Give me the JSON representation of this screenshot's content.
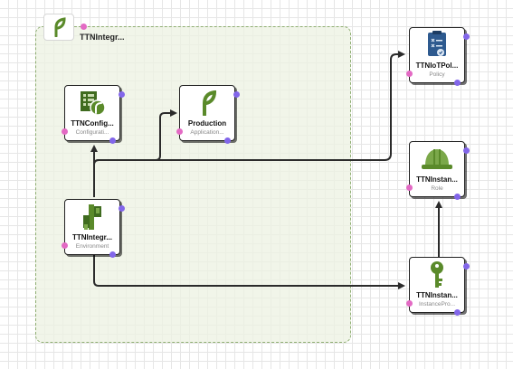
{
  "colors": {
    "group_border": "#8fae72",
    "group_fill": "#ecf1e2",
    "input_port": "#e36ac4",
    "output_port": "#8266ea",
    "edge": "#2b2b2b",
    "icon_green": "#5a8a2a"
  },
  "group": {
    "title": "TTNIntegr...",
    "icon": "elastic-beanstalk-leaf-icon"
  },
  "nodes": {
    "config": {
      "title": "TTNConfig...",
      "subtitle": "Configurati...",
      "icon": "configuration-template-icon"
    },
    "production": {
      "title": "Production",
      "subtitle": "Application...",
      "icon": "application-leaf-icon"
    },
    "environment": {
      "title": "TTNIntegr...",
      "subtitle": "Environment",
      "icon": "environment-icon"
    },
    "policy": {
      "title": "TTNIoTPol...",
      "subtitle": "Policy",
      "icon": "policy-icon"
    },
    "role": {
      "title": "TTNInstan...",
      "subtitle": "Role",
      "icon": "hard-hat-icon"
    },
    "profile": {
      "title": "TTNInstan...",
      "subtitle": "InstancePro...",
      "icon": "key-icon"
    }
  },
  "edges": [
    {
      "from": "environment",
      "to": "config"
    },
    {
      "from": "environment",
      "to": "production"
    },
    {
      "from": "environment",
      "to": "policy"
    },
    {
      "from": "environment",
      "to": "role"
    },
    {
      "from": "environment",
      "to": "profile"
    },
    {
      "from": "profile",
      "to": "role"
    }
  ]
}
